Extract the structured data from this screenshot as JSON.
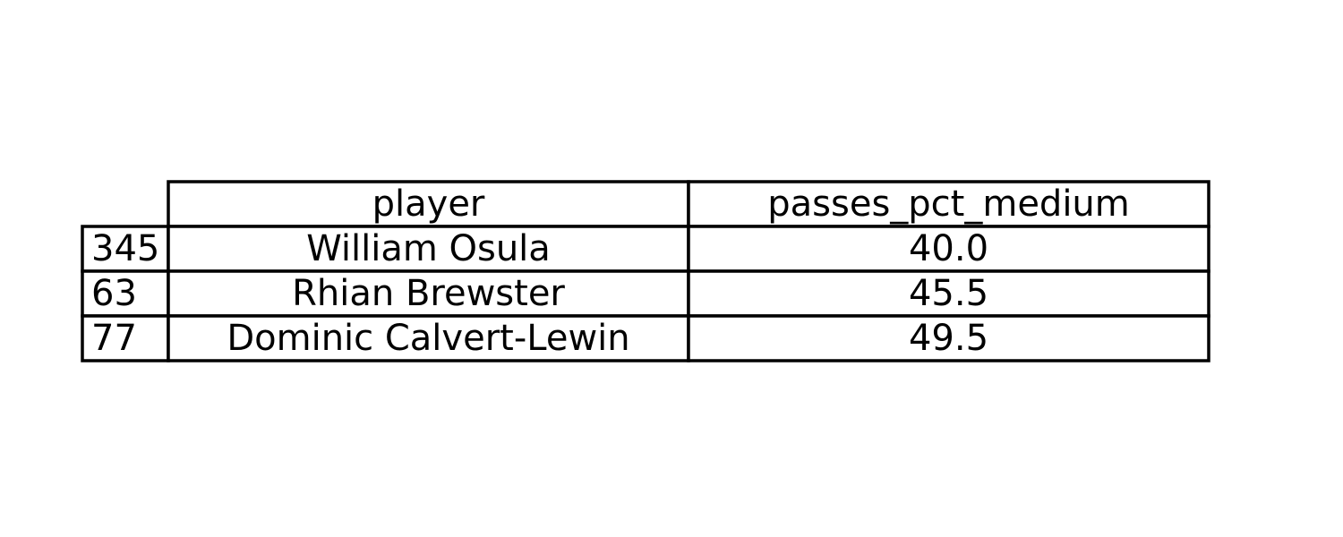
{
  "chart_data": {
    "type": "table",
    "columns": [
      "player",
      "passes_pct_medium"
    ],
    "rows": [
      {
        "index": "345",
        "cells": [
          "William Osula",
          "40.0"
        ]
      },
      {
        "index": "63",
        "cells": [
          "Rhian Brewster",
          "45.5"
        ]
      },
      {
        "index": "77",
        "cells": [
          "Dominic Calvert-Lewin",
          "49.5"
        ]
      }
    ]
  }
}
